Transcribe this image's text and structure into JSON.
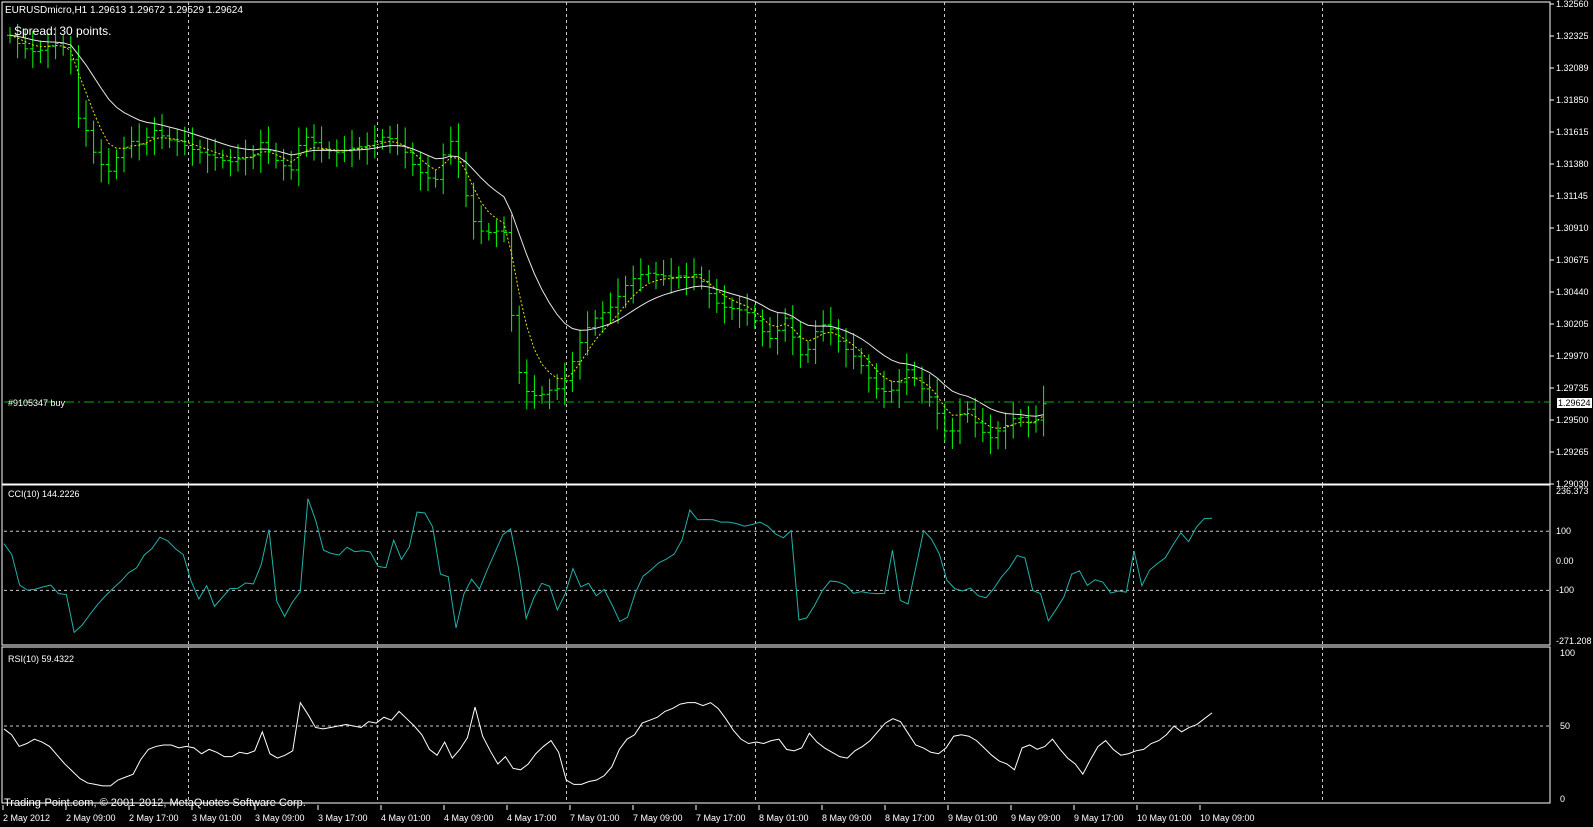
{
  "window": {
    "header": "EURUSDmicro,H1  1.29613 1.29672 1.29529 1.29624",
    "spread": "Spread: 30 points.",
    "order_label": "#9105347 buy",
    "current_price": "1.29624",
    "copyright": "Trading-Point.com, © 2001-2012, MetaQuotes Software Corp."
  },
  "colors": {
    "background": "#000000",
    "bars": "#00ff00",
    "slow_ma": "#e6e6e6",
    "fast_ma": "#e6e600",
    "cci": "#20b2aa",
    "rsi": "#ffffff",
    "order_line": "#00b000",
    "grid": "#c8c8c8"
  },
  "price_axis": [
    "1.32560",
    "1.32325",
    "1.32089",
    "1.31850",
    "1.31615",
    "1.31380",
    "1.31145",
    "1.30910",
    "1.30675",
    "1.30440",
    "1.30205",
    "1.29970",
    "1.29735",
    "1.29500",
    "1.29265",
    "1.29030"
  ],
  "time_axis": [
    "2 May 2012",
    "2 May 09:00",
    "2 May 17:00",
    "3 May 01:00",
    "3 May 09:00",
    "3 May 17:00",
    "4 May 01:00",
    "4 May 09:00",
    "4 May 17:00",
    "7 May 01:00",
    "7 May 09:00",
    "7 May 17:00",
    "8 May 01:00",
    "8 May 09:00",
    "8 May 17:00",
    "9 May 01:00",
    "9 May 09:00",
    "9 May 17:00",
    "10 May 01:00",
    "10 May 09:00"
  ],
  "cci_panel": {
    "label": "CCI(10) 144.2226",
    "axis": [
      "236.373",
      "100",
      "0.00",
      "-100",
      "-271.208"
    ]
  },
  "rsi_panel": {
    "label": "RSI(10) 59.4322",
    "axis": [
      "100",
      "50",
      "0"
    ]
  },
  "chart_data": {
    "type": "line",
    "price": {
      "ylim": [
        1.2903,
        1.3256
      ],
      "close_path": [
        1.3233,
        1.3227,
        1.3223,
        1.3221,
        1.3222,
        1.3225,
        1.3227,
        1.3224,
        1.3215,
        1.3172,
        1.3163,
        1.3147,
        1.3138,
        1.3133,
        1.3143,
        1.315,
        1.3155,
        1.3153,
        1.3158,
        1.3163,
        1.3159,
        1.3156,
        1.3155,
        1.3152,
        1.3149,
        1.3147,
        1.3145,
        1.3143,
        1.3141,
        1.314,
        1.3142,
        1.3143,
        1.3145,
        1.3154,
        1.3148,
        1.3141,
        1.3137,
        1.3134,
        1.3152,
        1.3158,
        1.3154,
        1.3149,
        1.3148,
        1.3147,
        1.3148,
        1.315,
        1.3151,
        1.3152,
        1.3155,
        1.3158,
        1.3157,
        1.3152,
        1.3147,
        1.3138,
        1.3132,
        1.3128,
        1.3127,
        1.3145,
        1.3155,
        1.314,
        1.3115,
        1.3096,
        1.3089,
        1.3088,
        1.3089,
        1.3088,
        1.3027,
        1.2985,
        1.2971,
        1.2968,
        1.2969,
        1.2972,
        1.2973,
        1.2979,
        1.2993,
        1.3007,
        1.3018,
        1.3025,
        1.3029,
        1.3033,
        1.3041,
        1.3049,
        1.3054,
        1.3057,
        1.3058,
        1.3057,
        1.3056,
        1.3055,
        1.3056,
        1.3055,
        1.3057,
        1.3052,
        1.3043,
        1.3036,
        1.3033,
        1.3032,
        1.3031,
        1.3029,
        1.3023,
        1.3015,
        1.301,
        1.3016,
        1.3025,
        1.3011,
        1.2998,
        1.3002,
        1.3015,
        1.302,
        1.3017,
        1.3008,
        1.3002,
        1.2997,
        1.299,
        1.2981,
        1.2973,
        1.2971,
        1.2972,
        1.2978,
        1.2987,
        1.2981,
        1.2973,
        1.2967,
        1.2955,
        1.2942,
        1.2942,
        1.2954,
        1.2958,
        1.2948,
        1.2941,
        1.2937,
        1.2942,
        1.2946,
        1.2951,
        1.2952,
        1.2948,
        1.295,
        1.2962
      ]
    },
    "cci": {
      "ylim": [
        -271.208,
        236.373
      ],
      "values": [
        58,
        21,
        -82,
        -99,
        -96,
        -88,
        -82,
        -111,
        -114,
        -242,
        -218,
        -182,
        -148,
        -119,
        -93,
        -69,
        -40,
        -24,
        20,
        42,
        80,
        68,
        41,
        21,
        -68,
        -129,
        -84,
        -154,
        -124,
        -94,
        -93,
        -75,
        -78,
        -13,
        106,
        -137,
        -188,
        -140,
        -105,
        211,
        136,
        36,
        25,
        20,
        46,
        31,
        34,
        30,
        -19,
        -23,
        70,
        5,
        47,
        165,
        162,
        115,
        -45,
        -54,
        -227,
        -113,
        -62,
        -96,
        -31,
        29,
        88,
        108,
        -23,
        -195,
        -124,
        -76,
        -86,
        -166,
        -112,
        -26,
        -88,
        -76,
        -118,
        -97,
        -148,
        -205,
        -191,
        -109,
        -52,
        -31,
        -7,
        6,
        23,
        71,
        172,
        139,
        140,
        139,
        131,
        131,
        126,
        117,
        123,
        131,
        117,
        91,
        78,
        102,
        -200,
        -193,
        -151,
        -101,
        -68,
        -71,
        -82,
        -110,
        -104,
        -109,
        -111,
        -110,
        36,
        -134,
        -146,
        -22,
        102,
        74,
        24,
        -66,
        -94,
        -102,
        -92,
        -118,
        -125,
        -94,
        -54,
        -24,
        18,
        10,
        -100,
        -111,
        -203,
        -164,
        -122,
        -45,
        -34,
        -83,
        -64,
        -72,
        -109,
        -102,
        -106,
        33,
        -84,
        -31,
        -9,
        10,
        54,
        95,
        65,
        114,
        143,
        144
      ]
    },
    "rsi": {
      "ylim": [
        0,
        100
      ],
      "values": [
        48,
        44,
        36,
        38,
        41,
        39,
        36,
        30,
        24,
        19,
        14,
        11,
        10,
        9,
        9,
        13,
        15,
        17,
        27,
        34,
        36,
        37,
        37,
        35,
        36,
        35,
        31,
        34,
        32,
        29,
        29,
        32,
        31,
        33,
        46,
        31,
        28,
        30,
        33,
        66,
        58,
        49,
        48,
        49,
        50,
        51,
        50,
        49,
        53,
        52,
        56,
        54,
        60,
        55,
        50,
        44,
        34,
        30,
        39,
        28,
        34,
        42,
        63,
        43,
        33,
        24,
        29,
        21,
        20,
        24,
        31,
        36,
        40,
        32,
        13,
        10,
        10,
        12,
        13,
        16,
        22,
        34,
        41,
        44,
        52,
        54,
        56,
        60,
        62,
        65,
        66,
        66,
        64,
        66,
        62,
        55,
        47,
        41,
        38,
        39,
        38,
        40,
        41,
        34,
        33,
        35,
        45,
        39,
        35,
        32,
        29,
        28,
        33,
        36,
        40,
        46,
        52,
        55,
        53,
        45,
        37,
        35,
        32,
        31,
        35,
        43,
        44,
        43,
        40,
        35,
        30,
        26,
        24,
        20,
        35,
        37,
        34,
        36,
        41,
        34,
        28,
        24,
        17,
        27,
        36,
        40,
        34,
        30,
        31,
        33,
        34,
        38,
        40,
        44,
        50,
        46,
        49,
        51,
        55,
        59
      ]
    }
  }
}
